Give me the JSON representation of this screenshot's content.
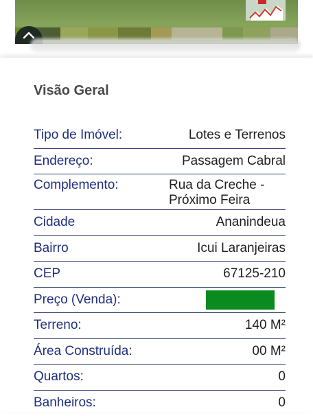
{
  "photo": {
    "grass_colors": [
      "#6b8e2a",
      "#4e5e33",
      "#9aa65a",
      "#8b9747",
      "#6e7a36",
      "#a39a55",
      "#b7b496",
      "#7e9850",
      "#8fa15c",
      "#aaa98a"
    ]
  },
  "overview": {
    "title": "Visão Geral",
    "rows": [
      {
        "label": "Tipo de Imóvel:",
        "value": "Lotes e Terrenos"
      },
      {
        "label": "Endereço:",
        "value": "Passagem Cabral"
      },
      {
        "label": "Complemento:",
        "value": "Rua da Creche - Próximo Feira"
      },
      {
        "label": "Cidade",
        "value": "Ananindeua"
      },
      {
        "label": "Bairro",
        "value": "Icui Laranjeiras"
      },
      {
        "label": "CEP",
        "value": "67125-210"
      },
      {
        "label": "Preço (Venda):",
        "value": ""
      },
      {
        "label": "Terreno:",
        "value": "140 M²"
      },
      {
        "label": "Área Construída:",
        "value": "00 M²"
      },
      {
        "label": "Quartos:",
        "value": "0"
      },
      {
        "label": "Banheiros:",
        "value": "0"
      }
    ]
  },
  "colors": {
    "label": "#1f2f80",
    "divider": "#2b3a6b",
    "redaction": "#0a8a1f"
  }
}
